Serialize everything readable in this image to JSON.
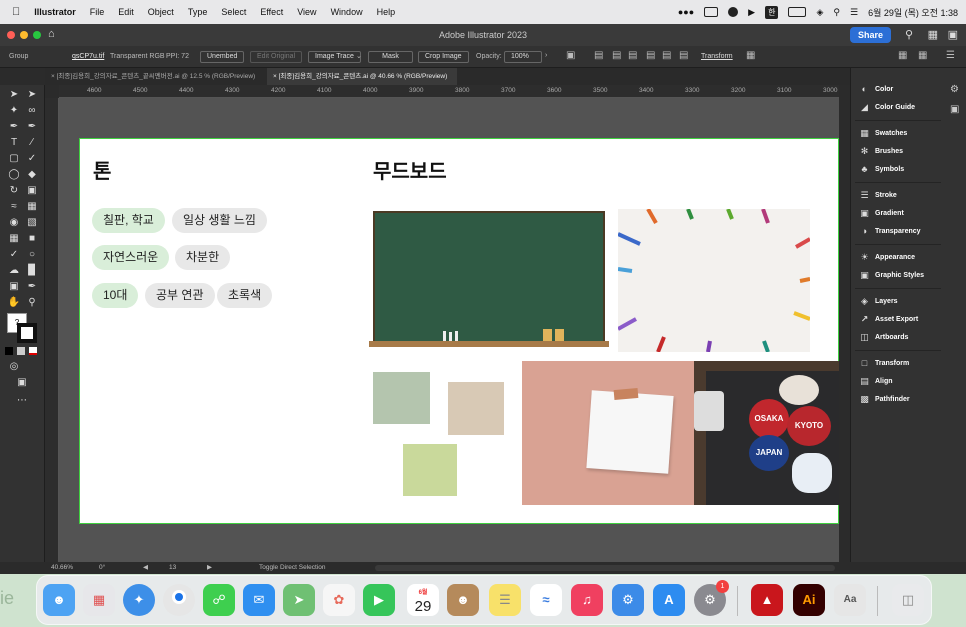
{
  "menubar": {
    "apple": "",
    "app_name": "Illustrator",
    "menus": [
      "File",
      "Edit",
      "Object",
      "Type",
      "Select",
      "Effect",
      "View",
      "Window",
      "Help"
    ],
    "clock": "6월 29일 (목) 오전 1:38",
    "input_source": "한"
  },
  "window": {
    "title": "Adobe Illustrator 2023",
    "share_label": "Share"
  },
  "controlbar": {
    "group_label": "Group",
    "file_name": "qsCP7u.tif",
    "color_mode": "Transparent RGB",
    "ppi": "PPI: 72",
    "unembed": "Unembed",
    "edit_original": "Edit Original",
    "image_trace": "Image Trace",
    "mask": "Mask",
    "crop_image": "Crop Image",
    "opacity_label": "Opacity:",
    "opacity_value": "100%",
    "transform": "Transform"
  },
  "tabs": [
    {
      "label": "[최종]김용희_강의자료_콘텐츠_끝씨멘버전.ai @ 12.5 % (RGB/Preview)",
      "active": false
    },
    {
      "label": "[최종]김용희_강의자료_콘텐츠.ai @ 40.66 % (RGB/Preview)",
      "active": true
    }
  ],
  "ruler": {
    "ticks": [
      "4600",
      "4500",
      "4400",
      "4300",
      "4200",
      "4100",
      "4000",
      "3900",
      "3800",
      "3700",
      "3600",
      "3500",
      "3400",
      "3300",
      "3200",
      "3100",
      "3000"
    ]
  },
  "artboard": {
    "tone_heading": "톤",
    "moodboard_heading": "무드보드",
    "chips": [
      {
        "label": "칠판, 학교",
        "style": "green"
      },
      {
        "label": "일상 생활 느낌",
        "style": "gray"
      },
      {
        "label": "자연스러운",
        "style": "green"
      },
      {
        "label": "차분한",
        "style": "gray"
      },
      {
        "label": "10대",
        "style": "green"
      },
      {
        "label": "공부 연관",
        "style": "gray"
      },
      {
        "label": "초록색",
        "style": "gray"
      }
    ],
    "sticker_texts": [
      "OSAKA",
      "KYOTO",
      "JAPAN"
    ]
  },
  "panels": [
    {
      "label": "Color",
      "icon": "color-icon"
    },
    {
      "label": "Color Guide",
      "icon": "color-guide-icon"
    },
    {
      "label": "Swatches",
      "icon": "swatches-icon"
    },
    {
      "label": "Brushes",
      "icon": "brushes-icon"
    },
    {
      "label": "Symbols",
      "icon": "symbols-icon"
    },
    {
      "label": "Stroke",
      "icon": "stroke-icon"
    },
    {
      "label": "Gradient",
      "icon": "gradient-icon"
    },
    {
      "label": "Transparency",
      "icon": "transparency-icon"
    },
    {
      "label": "Appearance",
      "icon": "appearance-icon"
    },
    {
      "label": "Graphic Styles",
      "icon": "graphic-styles-icon"
    },
    {
      "label": "Layers",
      "icon": "layers-icon"
    },
    {
      "label": "Asset Export",
      "icon": "asset-export-icon"
    },
    {
      "label": "Artboards",
      "icon": "artboards-icon"
    },
    {
      "label": "Transform",
      "icon": "transform-icon"
    },
    {
      "label": "Align",
      "icon": "align-icon"
    },
    {
      "label": "Pathfinder",
      "icon": "pathfinder-icon"
    }
  ],
  "status": {
    "zoom": "40.66%",
    "rotation": "0°",
    "artboard_number": "13",
    "tool_hint": "Toggle Direct Selection"
  },
  "dock": {
    "calendar_month": "6월",
    "calendar_day": "29",
    "settings_badge": "1",
    "ai_label": "Ai",
    "desktop_text": "ie"
  },
  "colors": {
    "selection": "#3fd13f",
    "chalkboard": "#2f5a44",
    "chip_green": "#d9eed9",
    "chip_gray": "#e8e8e8",
    "accent": "#2c6fd6"
  }
}
